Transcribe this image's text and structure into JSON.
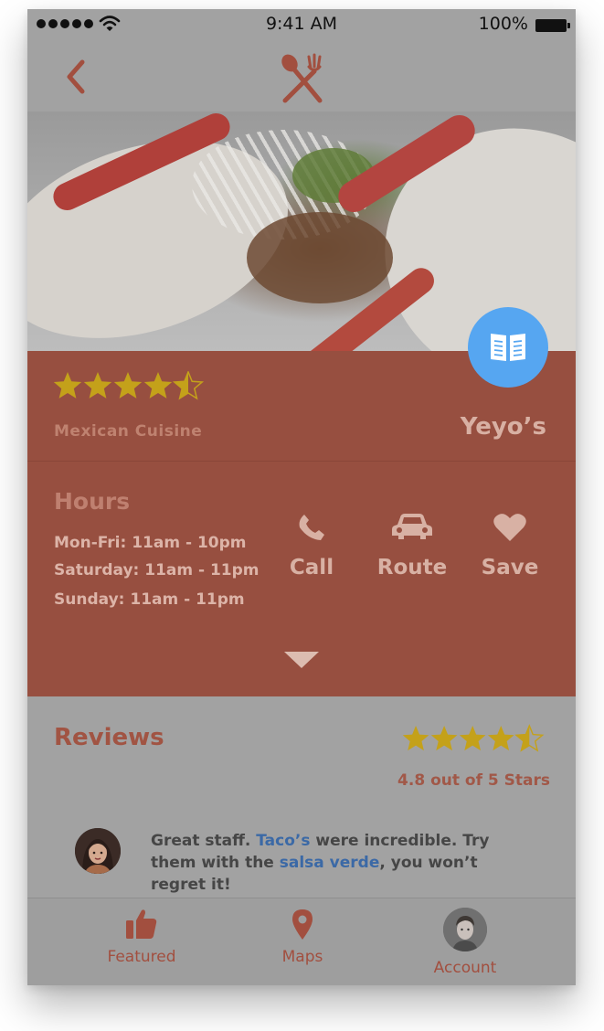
{
  "status_bar": {
    "time": "9:41 AM",
    "battery": "100%"
  },
  "restaurant": {
    "name": "Yeyo’s",
    "cuisine": "Mexican Cuisine",
    "rating_stars": 4.5
  },
  "hours": {
    "title": "Hours",
    "lines": [
      "Mon-Fri: 11am - 10pm",
      "Saturday: 11am - 11pm",
      "Sunday: 11am - 11pm"
    ]
  },
  "actions": {
    "call": "Call",
    "route": "Route",
    "save": "Save"
  },
  "reviews": {
    "title": "Reviews",
    "rating_text": "4.8 out of 5 Stars",
    "rating_stars": 4.5,
    "review": {
      "part1": "Great staff. ",
      "highlight1": "Taco’s",
      "part2": " were incredible. Try them with the ",
      "highlight2": "salsa verde",
      "part3": ", you won’t regret it!"
    }
  },
  "tabs": {
    "featured": "Featured",
    "maps": "Maps",
    "account": "Account"
  },
  "icons": {
    "back": "chevron-left-icon",
    "logo": "spoon-fork-icon",
    "menu": "book-icon",
    "call": "phone-icon",
    "route": "car-icon",
    "save": "heart-icon",
    "expand": "triangle-down-icon",
    "featured": "thumbs-up-icon",
    "maps": "map-pin-icon"
  },
  "colors": {
    "accent": "#a24f3f",
    "info_panel": "#974f40",
    "star": "#c4a11a",
    "fab": "#56a6f1",
    "link": "#3b69a6"
  }
}
